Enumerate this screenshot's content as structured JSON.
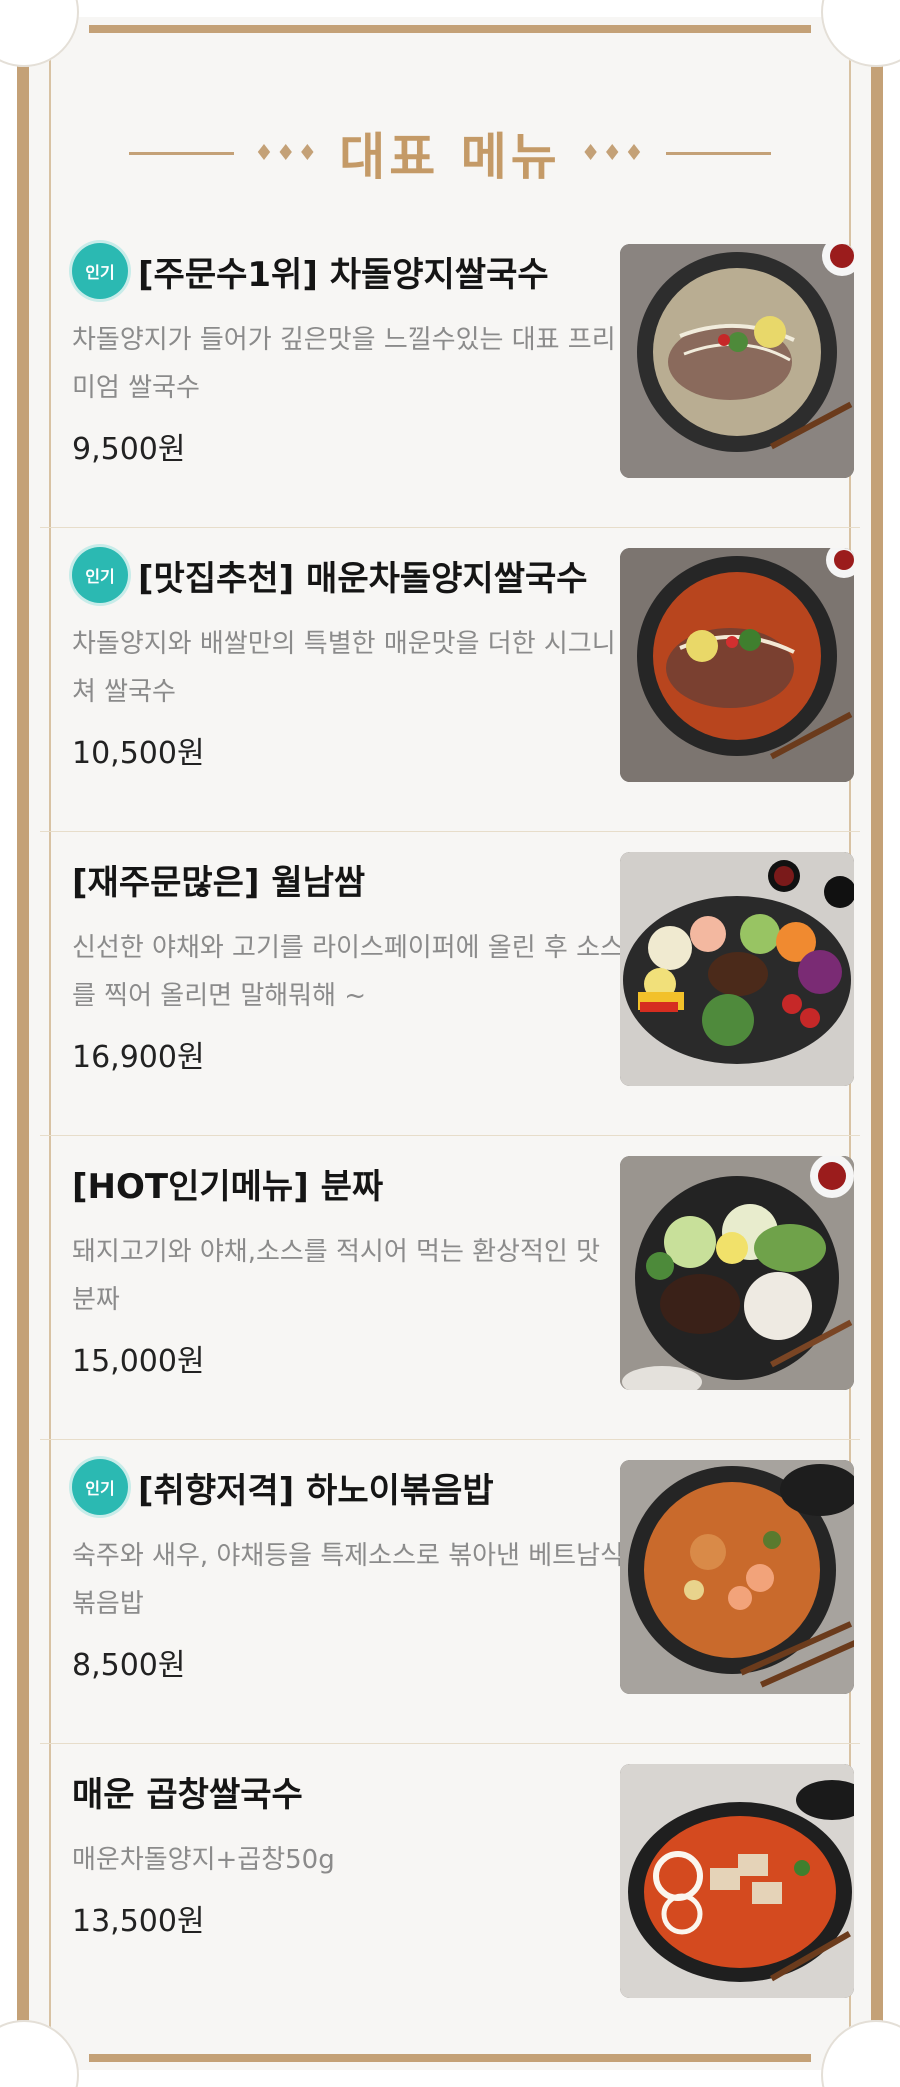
{
  "header": {
    "title": "대표 메뉴",
    "ornament_left": "♦♦♦",
    "ornament_right": "♦♦♦"
  },
  "colors": {
    "accent": "#c4a177",
    "badge": "#2bb9b2",
    "background": "#f7f6f4"
  },
  "menu": [
    {
      "badge": "인기",
      "name": "[주문수1위] 차돌양지쌀국수",
      "description": "차돌양지가 들어가 깊은맛을 느낄수있는 대표 프리미엄 쌀국수",
      "price": "9,500원",
      "photo": "clear-beef-pho"
    },
    {
      "badge": "인기",
      "name": "[맛집추천] 매운차돌양지쌀국수",
      "description": "차돌양지와 배쌀만의 특별한 매운맛을 더한 시그니쳐 쌀국수",
      "price": "10,500원",
      "photo": "spicy-beef-pho"
    },
    {
      "badge": "",
      "name": "[재주문많은] 월남쌈",
      "description": "신선한 야채와 고기를 라이스페이퍼에 올린 후 소스를 찍어 올리면 말해뭐해 ~",
      "price": "16,900원",
      "photo": "vietnamese-rice-paper-rolls-platter"
    },
    {
      "badge": "",
      "name": "[HOT인기메뉴] 분짜",
      "description": "돼지고기와 야채,소스를 적시어 먹는 환상적인 맛 분짜",
      "price": "15,000원",
      "photo": "bun-cha-bowl"
    },
    {
      "badge": "인기",
      "name": "[취향저격] 하노이볶음밥",
      "description": "숙주와 새우, 야채등을 특제소스로 볶아낸 베트남식 볶음밥",
      "price": "8,500원",
      "photo": "hanoi-fried-rice"
    },
    {
      "badge": "",
      "name": "매운 곱창쌀국수",
      "description": "매운차돌양지+곱창50g",
      "price": "13,500원",
      "photo": "spicy-gopchang-pho"
    }
  ]
}
